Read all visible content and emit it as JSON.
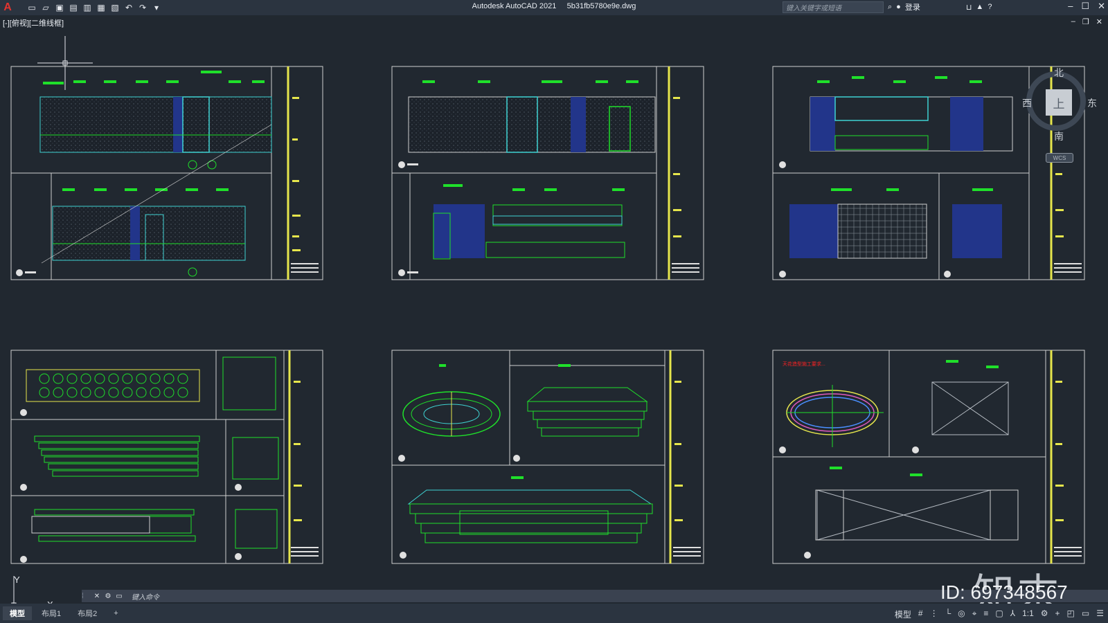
{
  "window": {
    "app_title": "Autodesk AutoCAD 2021",
    "file_name": "5b31fb5780e9e.dwg",
    "search_placeholder": "键入关键字或短语",
    "login_label": "登录"
  },
  "view": {
    "label": "[-][俯视][二维线框]"
  },
  "viewcube": {
    "north": "北",
    "south": "南",
    "east": "东",
    "west": "西",
    "face": "上",
    "wcs": "WCS"
  },
  "ucs": {
    "x_label": "X",
    "y_label": "Y"
  },
  "command": {
    "placeholder": "键入命令"
  },
  "layout_tabs": [
    {
      "label": "模型",
      "active": true
    },
    {
      "label": "布局1",
      "active": false
    },
    {
      "label": "布局2",
      "active": false
    },
    {
      "label": "+",
      "active": false
    }
  ],
  "status": {
    "model_label": "模型",
    "scale": "1:1"
  },
  "drawing_note": "天花造型施工要求...",
  "watermark": {
    "logo": "知末",
    "id": "ID: 697348567"
  },
  "colors": {
    "background": "#212830",
    "frame": "#d0d0d0",
    "titleblock": "#e6e64c",
    "label_green": "#1fe02a",
    "cyan": "#3fd3d3",
    "blue_fill": "#22358a",
    "red_note": "#ff2222"
  }
}
